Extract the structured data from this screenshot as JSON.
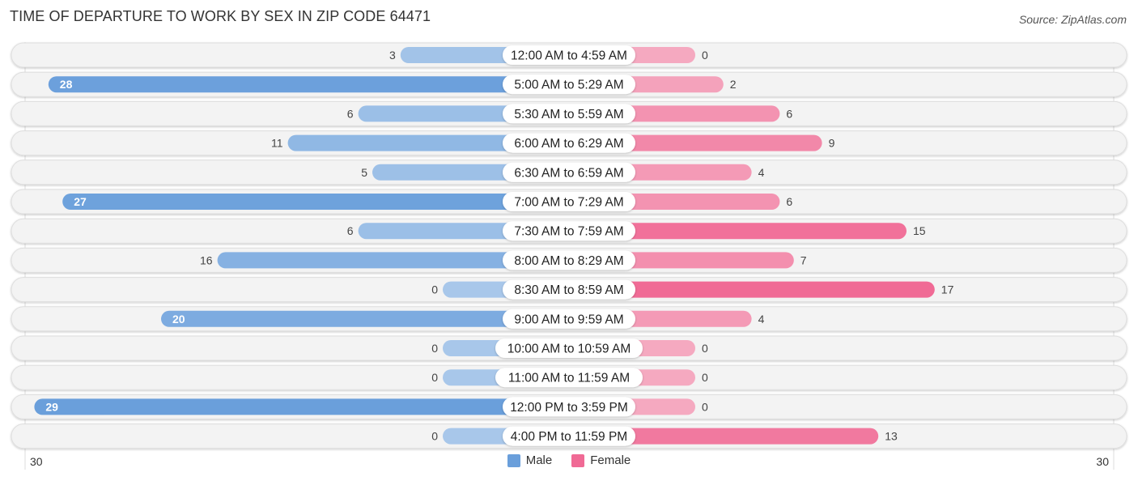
{
  "header": {
    "title": "TIME OF DEPARTURE TO WORK BY SEX IN ZIP CODE 64471",
    "source": "Source: ZipAtlas.com"
  },
  "colors": {
    "male": "#6a9fdb",
    "male_light": "#a8c7ea",
    "female": "#f06a95",
    "female_light": "#f5a9c0",
    "row_bg": "#f3f3f3",
    "label_bg": "#ffffff"
  },
  "legend": {
    "male_label": "Male",
    "female_label": "Female"
  },
  "axis": {
    "left_label": "30",
    "right_label": "30"
  },
  "chart_data": {
    "type": "bar",
    "orientation": "horizontal-butterfly",
    "title": "TIME OF DEPARTURE TO WORK BY SEX IN ZIP CODE 64471",
    "xlabel": "",
    "ylabel": "",
    "xlim": [
      30,
      30
    ],
    "legend_position": "bottom-center",
    "categories": [
      "12:00 AM to 4:59 AM",
      "5:00 AM to 5:29 AM",
      "5:30 AM to 5:59 AM",
      "6:00 AM to 6:29 AM",
      "6:30 AM to 6:59 AM",
      "7:00 AM to 7:29 AM",
      "7:30 AM to 7:59 AM",
      "8:00 AM to 8:29 AM",
      "8:30 AM to 8:59 AM",
      "9:00 AM to 9:59 AM",
      "10:00 AM to 10:59 AM",
      "11:00 AM to 11:59 AM",
      "12:00 PM to 3:59 PM",
      "4:00 PM to 11:59 PM"
    ],
    "series": [
      {
        "name": "Male",
        "values": [
          3,
          28,
          6,
          11,
          5,
          27,
          6,
          16,
          0,
          20,
          0,
          0,
          29,
          0
        ]
      },
      {
        "name": "Female",
        "values": [
          0,
          2,
          6,
          9,
          4,
          6,
          15,
          7,
          17,
          4,
          0,
          0,
          0,
          13
        ]
      }
    ]
  }
}
